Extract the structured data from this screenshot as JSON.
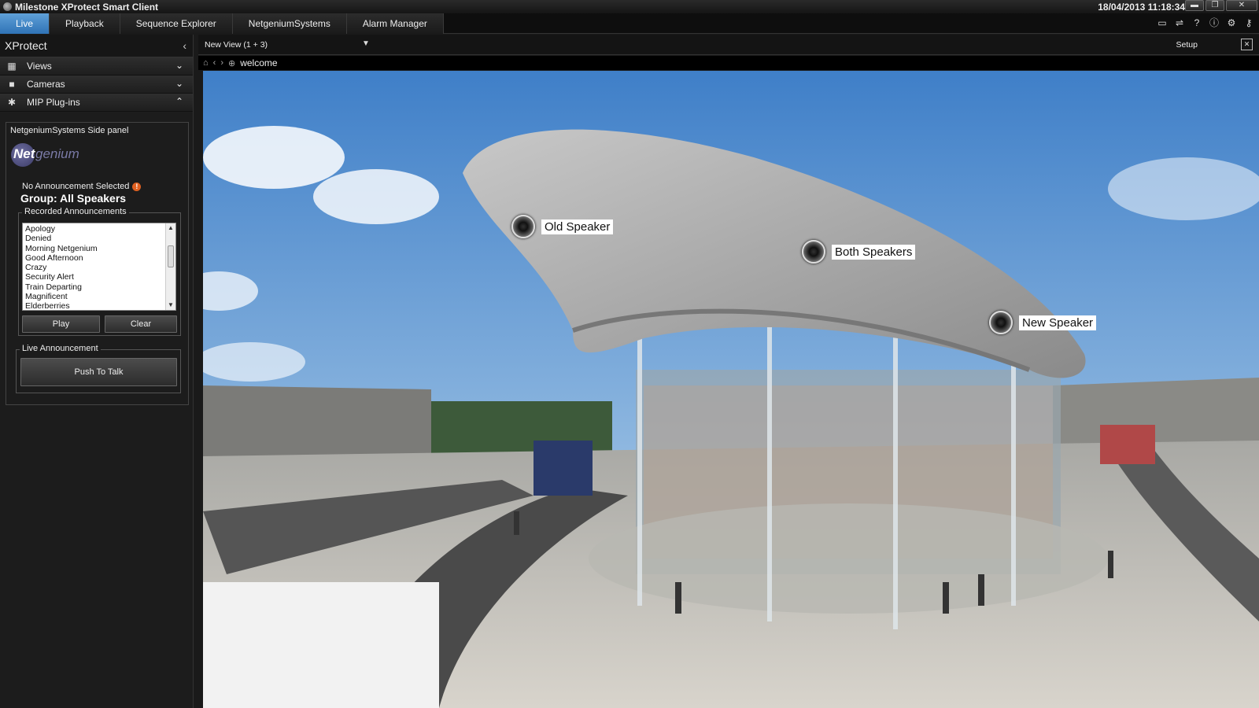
{
  "window": {
    "title": "Milestone XProtect Smart Client",
    "clock": "18/04/2013 11:18:34",
    "minimize": "▬",
    "restore": "❐",
    "close": "✕"
  },
  "tabs": [
    {
      "label": "Live",
      "active": true
    },
    {
      "label": "Playback"
    },
    {
      "label": "Sequence Explorer"
    },
    {
      "label": "NetgeniumSystems"
    },
    {
      "label": "Alarm Manager"
    }
  ],
  "sidebar": {
    "header": "XProtect",
    "sections": [
      {
        "label": "Views"
      },
      {
        "label": "Cameras"
      },
      {
        "label": "MIP Plug-ins"
      }
    ]
  },
  "plugin": {
    "title": "NetgeniumSystems Side panel",
    "logo_a": "Net",
    "logo_b": "genium",
    "status": "No Announcement Selected",
    "warn": "!",
    "group": "Group: All Speakers",
    "recorded_legend": "Recorded Announcements",
    "announcements": [
      "Apology",
      "Denied",
      "Morning Netgenium",
      "Good Afternoon",
      "Crazy",
      "Security Alert",
      "Train Departing",
      "Magnificent",
      "Elderberries"
    ],
    "play_label": "Play",
    "clear_label": "Clear",
    "live_legend": "Live Announcement",
    "push_label": "Push To Talk"
  },
  "view": {
    "name": "New View (1 + 3)",
    "setup": "Setup",
    "page": "welcome"
  },
  "speakers": [
    {
      "label": "Old Speaker"
    },
    {
      "label": "Both Speakers"
    },
    {
      "label": "New Speaker"
    }
  ]
}
